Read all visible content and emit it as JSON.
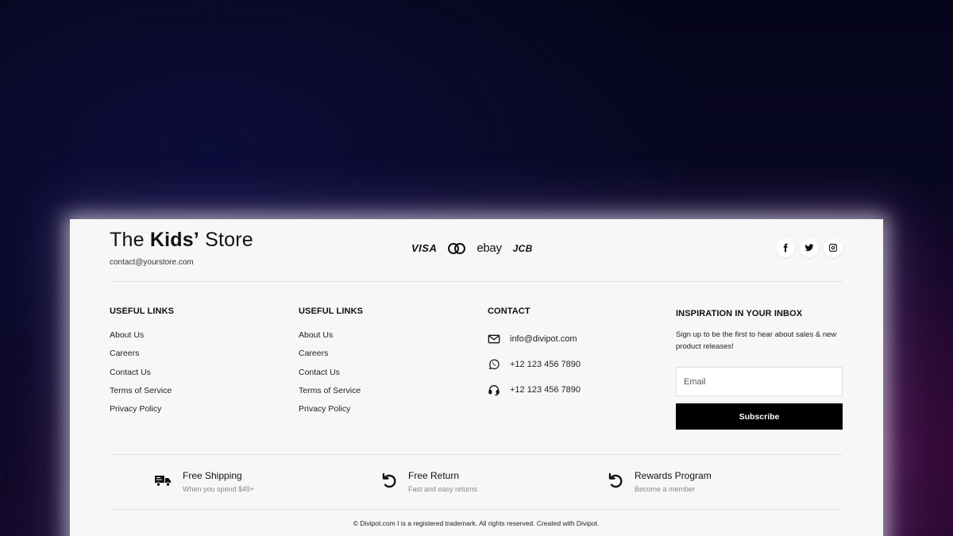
{
  "brand": {
    "title_prefix": "The ",
    "title_bold": "Kids’",
    "title_suffix": " Store",
    "email": "contact@yourstore.com"
  },
  "payments": [
    {
      "label": "VISA",
      "icon": "visa-logo"
    },
    {
      "label": "",
      "icon": "mastercard-logo"
    },
    {
      "label": "ebay",
      "icon": "ebay-logo"
    },
    {
      "label": "JCB",
      "icon": "jcb-logo"
    }
  ],
  "social": [
    {
      "icon": "facebook-icon"
    },
    {
      "icon": "twitter-icon"
    },
    {
      "icon": "instagram-icon"
    }
  ],
  "columns": {
    "useful1": {
      "heading": "USEFUL LINKS",
      "links": [
        "About Us",
        "Careers",
        "Contact Us",
        "Terms of Service",
        "Privacy Policy"
      ]
    },
    "useful2": {
      "heading": "USEFUL LINKS",
      "links": [
        "About Us",
        "Careers",
        "Contact Us",
        "Terms of Service",
        "Privacy Policy"
      ]
    },
    "contact": {
      "heading": "CONTACT",
      "items": [
        {
          "icon": "mail-icon",
          "text": "info@divipot.com"
        },
        {
          "icon": "whatsapp-icon",
          "text": "+12 123 456 7890"
        },
        {
          "icon": "headset-icon",
          "text": "+12 123 456 7890"
        }
      ]
    },
    "newsletter": {
      "heading": "INSPIRATION IN YOUR INBOX",
      "text": "Sign up to be the first to hear about sales & new product releases!",
      "email_placeholder": "Email",
      "button_label": "Subscribe"
    }
  },
  "features": [
    {
      "icon": "truck-icon",
      "title": "Free Shipping",
      "subtitle": "When you spend $49+"
    },
    {
      "icon": "return-icon",
      "title": "Free Return",
      "subtitle": "Fast and easy returns"
    },
    {
      "icon": "rewards-icon",
      "title": "Rewards Program",
      "subtitle": "Become a member"
    }
  ],
  "copyright": "© Divipot.com I is a registered trademark. All rights reserved. Created with Divipot."
}
